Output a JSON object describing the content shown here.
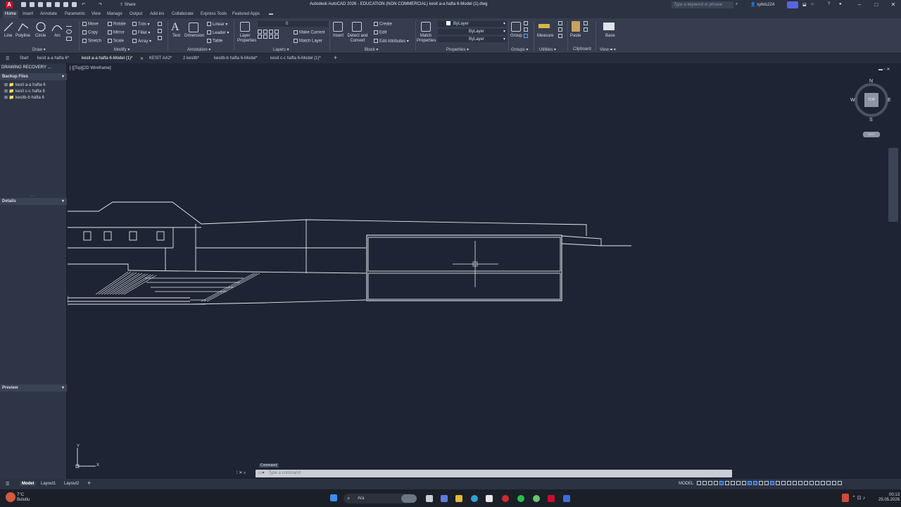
{
  "app": {
    "logo_letter": "A",
    "title": "Autodesk AutoCAD 2026 - EDUCATION (NON COMMERCIAL)    kesit a-a hafta 6-Model (1).dwg",
    "share_label": "Share",
    "search_placeholder": "Type a keyword or phrase",
    "user": "sylkts224"
  },
  "ribbon_tabs": [
    "Home",
    "Insert",
    "Annotate",
    "Parametric",
    "View",
    "Manage",
    "Output",
    "Add-ins",
    "Collaborate",
    "Express Tools",
    "Featured Apps"
  ],
  "draw": {
    "line": "Line",
    "polyline": "Polyline",
    "circle": "Circle",
    "arc": "Arc",
    "title": "Draw"
  },
  "modify": {
    "move": "Move",
    "rotate": "Rotate",
    "trim": "Trim",
    "copy": "Copy",
    "mirror": "Mirror",
    "fillet": "Fillet",
    "stretch": "Stretch",
    "scale": "Scale",
    "array": "Array",
    "title": "Modify"
  },
  "annotation": {
    "text": "Text",
    "dimension": "Dimension",
    "linear": "Linear",
    "leader": "Leader",
    "table": "Table",
    "title": "Annotation"
  },
  "layers": {
    "props": "Layer Properties",
    "current_layer": "0",
    "make_current": "Make Current",
    "match_layer": "Match Layer",
    "title": "Layers"
  },
  "block": {
    "insert": "Insert",
    "detect": "Detect and Convert",
    "create": "Create",
    "edit": "Edit",
    "edit_attr": "Edit Attributes",
    "title": "Block"
  },
  "properties": {
    "match": "Match Properties",
    "bylayer1": "ByLayer",
    "bylayer2": "ByLayer",
    "bylayer3": "ByLayer",
    "title": "Properties"
  },
  "groups": {
    "group": "Group",
    "title": "Groups"
  },
  "utilities": {
    "measure": "Measure",
    "title": "Utilities"
  },
  "clipboard": {
    "paste": "Paste",
    "title": "Clipboard"
  },
  "view": {
    "base": "Base",
    "title": "View"
  },
  "doc_tabs": [
    "Start",
    "kesit a-a hafta 6*",
    "kesit a-a hafta 6-Model (1)*",
    "KESİT AA2*",
    "2 kesitb*",
    "kesitb-b hafta 6-Model*",
    "kesit c-c hafta 6-Model (1)*"
  ],
  "left_panel": {
    "title": "DRAWING RECOVERY ...",
    "backup_section": "Backup Files",
    "files": [
      "kesit a-a hafta 6",
      "kesit c-c hafta 6",
      "kesitb-b hafta 6"
    ],
    "details_section": "Details",
    "preview_section": "Preview"
  },
  "viewport": {
    "label": "[-][Top][2D Wireframe]"
  },
  "viewcube": {
    "north": "N",
    "south": "S",
    "east": "E",
    "west": "W",
    "face": "TOP",
    "wcs": "WCS"
  },
  "ucs": {
    "x": "X",
    "y": "Y"
  },
  "command": {
    "tooltip": "Command:",
    "placeholder": "Type a command"
  },
  "layout_tabs": [
    "Model",
    "Layout1",
    "Layout2"
  ],
  "status": {
    "model": "MODEL"
  },
  "taskbar": {
    "weather_temp": "7°C",
    "weather_desc": "Bulutlu",
    "search": "Ara",
    "time": "00:13",
    "date": "25.05.2026"
  }
}
